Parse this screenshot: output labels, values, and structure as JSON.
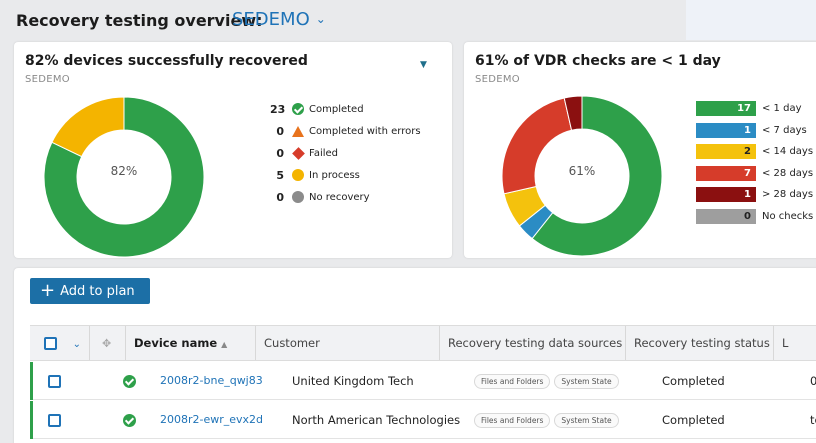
{
  "header": {
    "title": "Recovery testing overview:",
    "customer": "SEDEMO"
  },
  "card1": {
    "title": "82% devices successfully recovered",
    "subtitle": "SEDEMO",
    "center_label": "82%",
    "legend": [
      {
        "count": "23",
        "label": "Completed",
        "icon": "check-circle-icon",
        "color": "#2ea04a"
      },
      {
        "count": "0",
        "label": "Completed with errors",
        "icon": "warning-icon",
        "color": "#e8731c"
      },
      {
        "count": "0",
        "label": "Failed",
        "icon": "failed-icon",
        "color": "#d63c2a"
      },
      {
        "count": "5",
        "label": "In process",
        "icon": "in-process-icon",
        "color": "#f4b400"
      },
      {
        "count": "0",
        "label": "No recovery",
        "icon": "no-recovery-icon",
        "color": "#8b8b8b"
      }
    ]
  },
  "card2": {
    "title": "61% of VDR checks are < 1 day",
    "subtitle": "SEDEMO",
    "center_label": "61%",
    "legend": [
      {
        "count": "17",
        "label": "< 1 day",
        "color": "#2ea04a"
      },
      {
        "count": "1",
        "label": "< 7 days",
        "color": "#2b8cc4"
      },
      {
        "count": "2",
        "label": "< 14 days",
        "color": "#f4c20d"
      },
      {
        "count": "7",
        "label": "< 28 days",
        "color": "#d63c2a"
      },
      {
        "count": "1",
        "label": "> 28 days",
        "color": "#8b1010"
      },
      {
        "count": "0",
        "label": "No checks",
        "color": "#9e9e9e"
      }
    ]
  },
  "chart_data": [
    {
      "type": "pie",
      "title": "82% devices successfully recovered",
      "categories": [
        "Completed",
        "Completed with errors",
        "Failed",
        "In process",
        "No recovery"
      ],
      "values": [
        23,
        0,
        0,
        5,
        0
      ]
    },
    {
      "type": "pie",
      "title": "61% of VDR checks are < 1 day",
      "categories": [
        "< 1 day",
        "< 7 days",
        "< 14 days",
        "< 28 days",
        "> 28 days",
        "No checks"
      ],
      "values": [
        17,
        1,
        2,
        7,
        1,
        0
      ]
    }
  ],
  "toolbar": {
    "add_label": "Add to plan"
  },
  "table": {
    "columns": {
      "device_name": "Device name",
      "customer": "Customer",
      "sources": "Recovery testing data sources",
      "status": "Recovery testing status",
      "next": "L"
    },
    "rows": [
      {
        "device": "2008r2-bne_qwj83",
        "customer": "United Kingdom Tech",
        "sources": [
          "Files and Folders",
          "System State"
        ],
        "status": "Completed",
        "next": "0"
      },
      {
        "device": "2008r2-ewr_evx2d",
        "customer": "North American Technologies",
        "sources": [
          "Files and Folders",
          "System State"
        ],
        "status": "Completed",
        "next": "te"
      }
    ]
  }
}
